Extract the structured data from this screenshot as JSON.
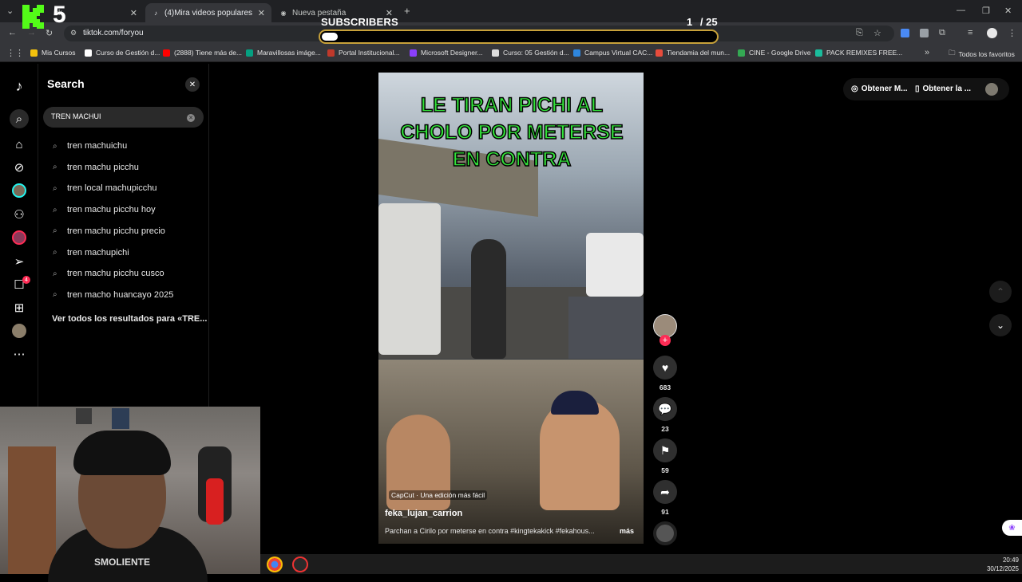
{
  "browser": {
    "tabs": [
      {
        "label": "ck",
        "active": false
      },
      {
        "label": "(4)Mira videos populares selec",
        "active": true
      },
      {
        "label": "Nueva pestaña",
        "active": false
      }
    ],
    "url": "tiktok.com/foryou",
    "bookmarks": [
      {
        "label": "Mis Cursos",
        "color": "#f4c20d"
      },
      {
        "label": "Curso de Gestión d...",
        "color": "#ffffff"
      },
      {
        "label": "(2888) Tiene más de...",
        "color": "#ff0000"
      },
      {
        "label": "Maravillosas imáge...",
        "color": "#05a081"
      },
      {
        "label": "Portal Institucional...",
        "color": "#c0392b"
      },
      {
        "label": "Microsoft Designer...",
        "color": "#8a3ffc"
      },
      {
        "label": "Curso: 05 Gestión d...",
        "color": "#dddddd"
      },
      {
        "label": "Campus Virtual CAC...",
        "color": "#2e86de"
      },
      {
        "label": "Tiendamia del mun...",
        "color": "#e74c3c"
      },
      {
        "label": "CINE - Google Drive",
        "color": "#34a853"
      },
      {
        "label": "PACK REMIXES FREE...",
        "color": "#1abc9c"
      }
    ],
    "bookmarks_folder": "Todos los favoritos"
  },
  "overlay": {
    "logo_number": "5",
    "subscribers_label": "SUBSCRIBERS",
    "subscribers_current": "1",
    "subscribers_goal": "/ 25",
    "progress_fraction": 0.04,
    "accent_color": "#c8a23a"
  },
  "search": {
    "title": "Search",
    "query": "TREN MACHUI",
    "suggestions": [
      "tren machuichu",
      "tren machu picchu",
      "tren local machupicchu",
      "tren machu picchu hoy",
      "tren machu picchu precio",
      "tren machupichi",
      "tren machu picchu cusco",
      "tren macho huancayo 2025"
    ],
    "view_all": "Ver todos los resultados para «TRE..."
  },
  "sidebar": {
    "inbox_badge": "4"
  },
  "video": {
    "caption": "LE TIRAN PICHI AL CHOLO POR METERSE EN CONTRA",
    "capcut": "CapCut · Una edición más fácil",
    "author": "feka_lujan_carrion",
    "description": "Parchan a Cirilo por meterse en contra #kingtekakick #fekahous...",
    "more": "más",
    "likes": "683",
    "comments": "23",
    "saves": "59",
    "shares": "91"
  },
  "topright": {
    "get_coins": "Obtener M...",
    "get_app": "Obtener la ..."
  },
  "taskbar": {
    "time": "20:49",
    "date": "30/12/2025"
  },
  "webcam": {
    "shirt_text": "SMOLIENTE"
  }
}
